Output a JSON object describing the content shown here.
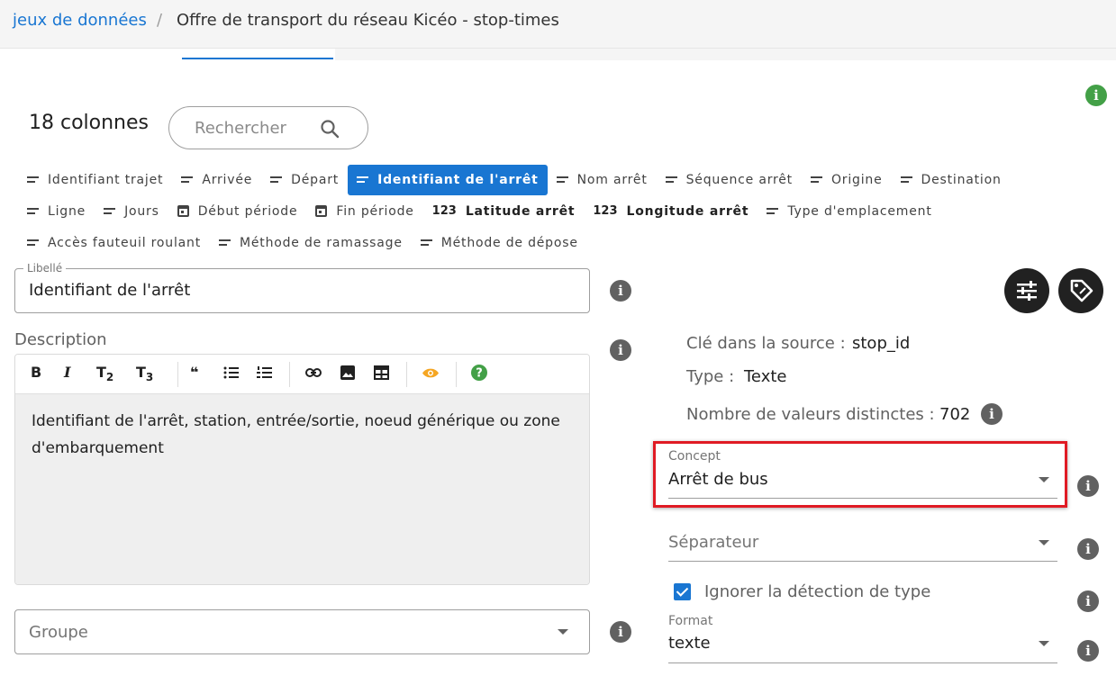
{
  "breadcrumb": {
    "link": "jeux de données",
    "separator": "/",
    "current": "Offre de transport du réseau Kicéo - stop-times"
  },
  "info_icon_letter": "i",
  "columns_count": "18 colonnes",
  "search": {
    "placeholder": "Rechercher"
  },
  "chips": [
    {
      "label": "Identifiant trajet",
      "icon": "text-lines-icon"
    },
    {
      "label": "Arrivée",
      "icon": "text-lines-icon"
    },
    {
      "label": "Départ",
      "icon": "text-lines-icon"
    },
    {
      "label": "Identifiant de l'arrêt",
      "icon": "text-lines-icon",
      "selected": true
    },
    {
      "label": "Nom arrêt",
      "icon": "text-lines-icon"
    },
    {
      "label": "Séquence arrêt",
      "icon": "text-lines-icon"
    },
    {
      "label": "Origine",
      "icon": "text-lines-icon"
    },
    {
      "label": "Destination",
      "icon": "text-lines-icon"
    },
    {
      "label": "Ligne",
      "icon": "text-lines-icon"
    },
    {
      "label": "Jours",
      "icon": "text-lines-icon"
    },
    {
      "label": "Début période",
      "icon": "calendar-icon"
    },
    {
      "label": "Fin période",
      "icon": "calendar-icon"
    },
    {
      "label": "Latitude arrêt",
      "icon": "number-icon",
      "icon_text": "123"
    },
    {
      "label": "Longitude arrêt",
      "icon": "number-icon",
      "icon_text": "123"
    },
    {
      "label": "Type d'emplacement",
      "icon": "text-lines-icon"
    },
    {
      "label": "Accès fauteuil roulant",
      "icon": "text-lines-icon"
    },
    {
      "label": "Méthode de ramassage",
      "icon": "text-lines-icon"
    },
    {
      "label": "Méthode de dépose",
      "icon": "text-lines-icon"
    }
  ],
  "libelle": {
    "label": "Libellé",
    "value": "Identifiant de l'arrêt"
  },
  "description": {
    "label": "Description",
    "toolbar": {
      "bold": "B",
      "italic": "I",
      "h2": "T",
      "h2_sub": "2",
      "h3": "T",
      "h3_sub": "3",
      "quote": "❝"
    },
    "text": "Identifiant de l'arrêt, station, entrée/sortie, noeud générique ou zone d'embarquement"
  },
  "groupe": {
    "placeholder": "Groupe"
  },
  "meta": {
    "source_key_label": "Clé dans la source :",
    "source_key_value": "stop_id",
    "type_label": "Type :",
    "type_value": "Texte",
    "distinct_label": "Nombre de valeurs distinctes :",
    "distinct_value": "702"
  },
  "concept": {
    "label": "Concept",
    "value": "Arrêt de bus"
  },
  "separateur": {
    "placeholder": "Séparateur"
  },
  "ignore_detection": {
    "label": "Ignorer la détection de type",
    "checked": true
  },
  "format": {
    "label": "Format",
    "value": "texte"
  },
  "colors": {
    "accent": "#1976d2",
    "highlight": "#e01b24",
    "success": "#43a047",
    "preview": "#f5a623"
  }
}
